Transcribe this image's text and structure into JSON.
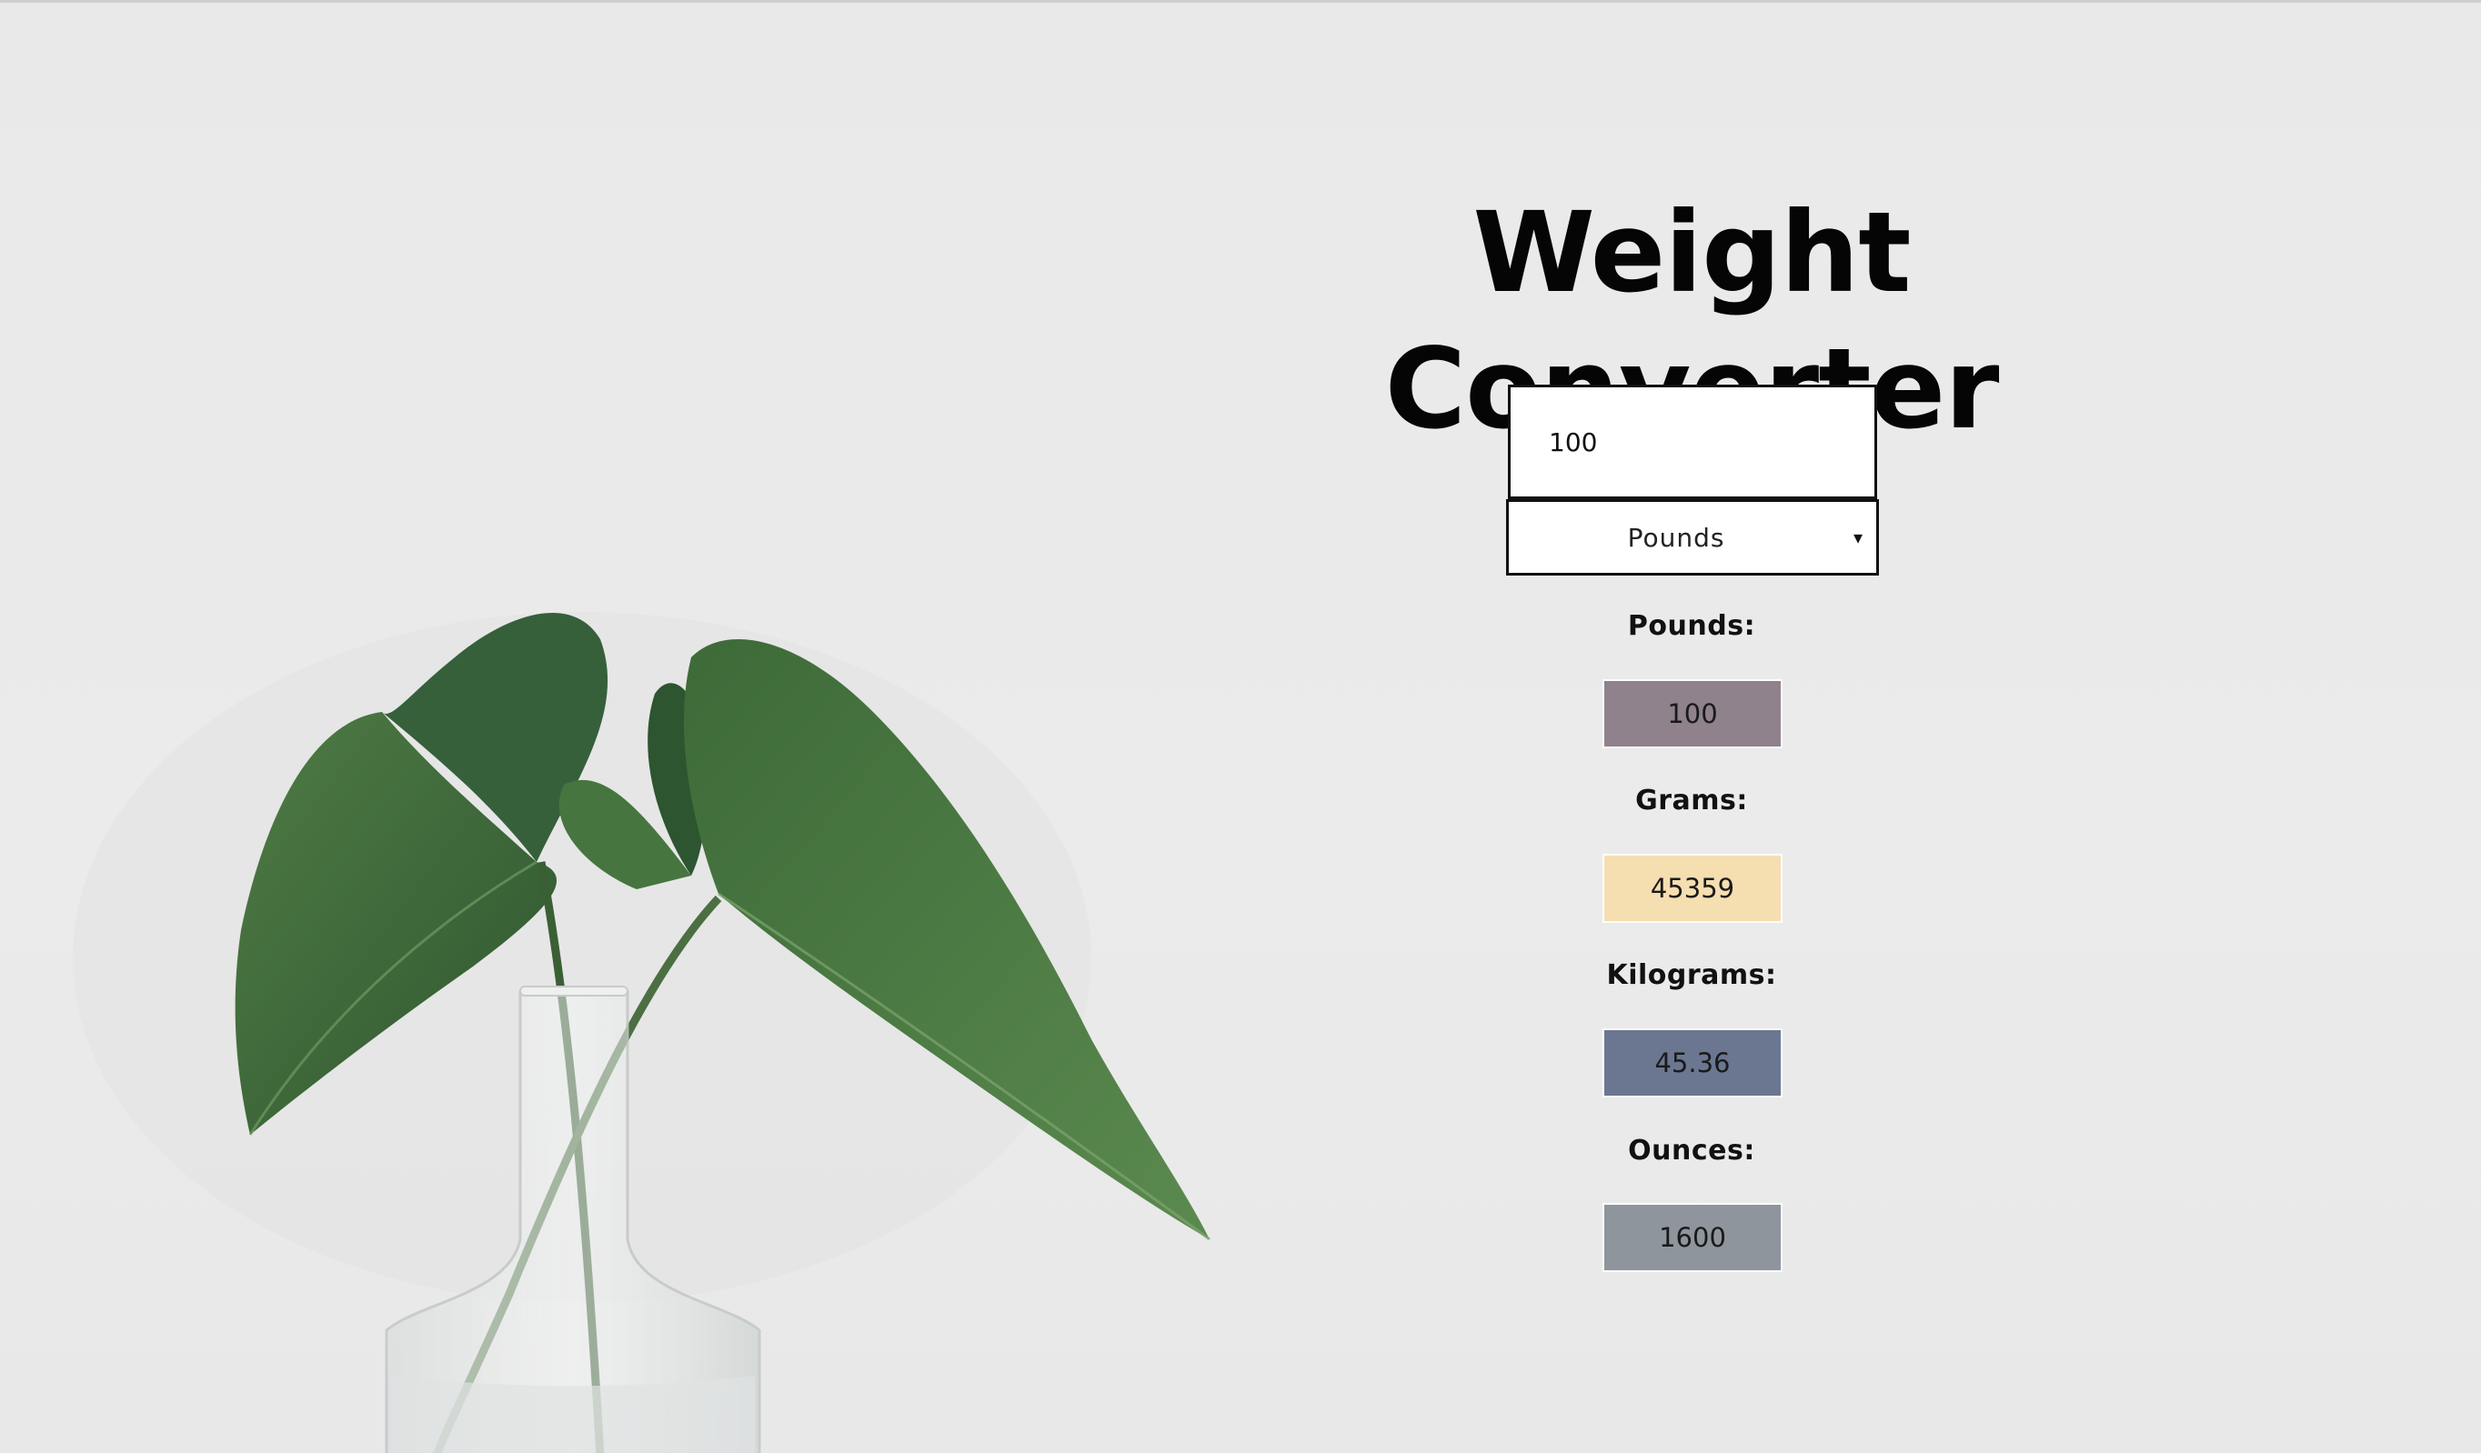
{
  "title": "Weight Converter",
  "input": {
    "value": "100"
  },
  "unit_select": {
    "selected": "Pounds",
    "caret": "▾"
  },
  "outputs": [
    {
      "label": "Pounds:",
      "value": "100",
      "color": "#8f828c"
    },
    {
      "label": "Grams:",
      "value": "45359",
      "color": "#f5deb0"
    },
    {
      "label": "Kilograms:",
      "value": "45.36",
      "color": "#6b7691"
    },
    {
      "label": "Ounces:",
      "value": "1600",
      "color": "#8e959d"
    }
  ],
  "colors": {
    "background": "#eaeaea",
    "leaf": "#3f6a3a",
    "text": "#050505"
  }
}
